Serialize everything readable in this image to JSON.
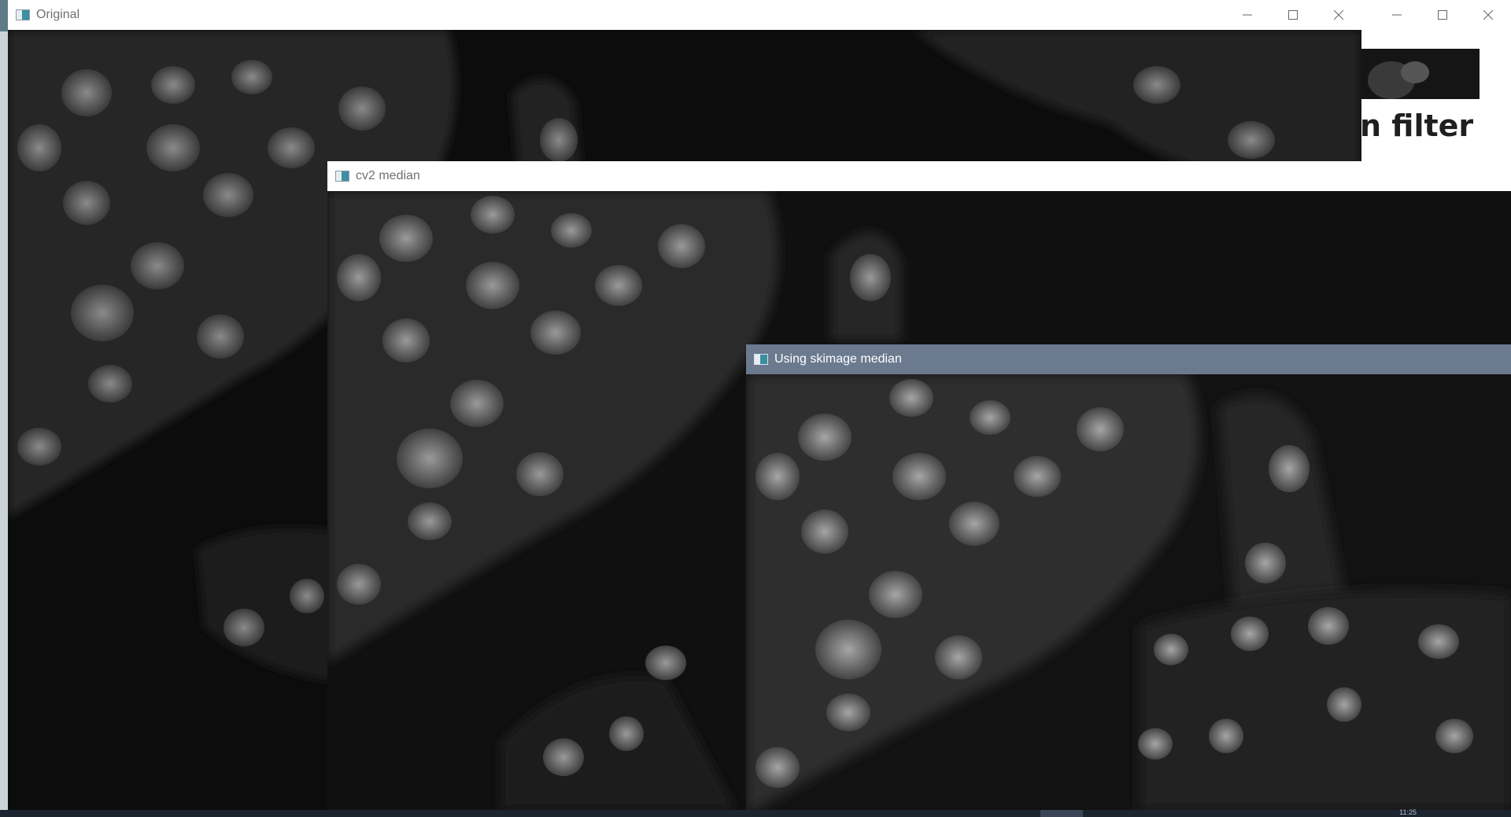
{
  "windows": {
    "original": {
      "title": "Original"
    },
    "cv2": {
      "title": "cv2 median"
    },
    "skimage": {
      "title": "Using skimage median"
    }
  },
  "background_window": {
    "heading_fragment": "n filter"
  },
  "taskbar": {
    "clock": "11:25"
  },
  "icons": {
    "app": "opencv-window-icon",
    "minimize": "minimize-icon",
    "maximize": "maximize-icon",
    "close": "close-icon"
  },
  "colors": {
    "active_titlebar": "#6b7a8f",
    "inactive_titlebar": "#ffffff",
    "image_background": "#0e0e0e"
  }
}
